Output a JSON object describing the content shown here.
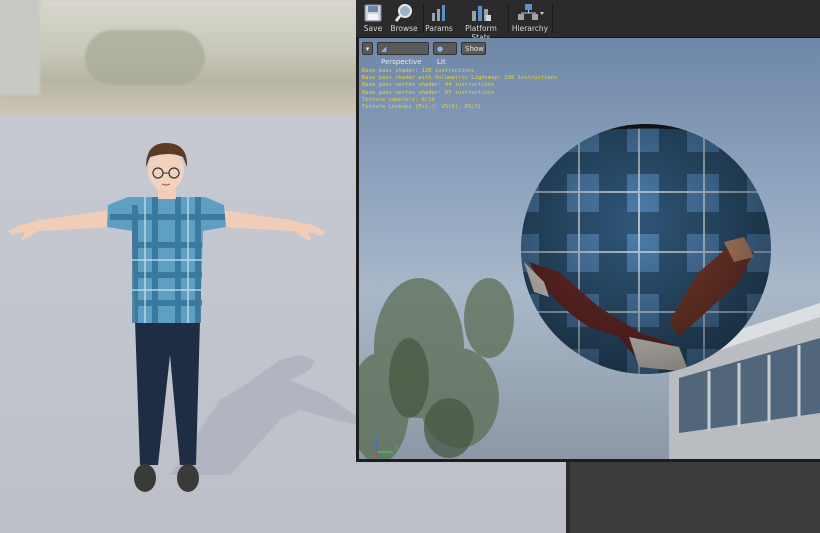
{
  "toolbar": {
    "buttons": [
      {
        "label": "Save",
        "icon": "save-icon"
      },
      {
        "label": "Browse",
        "icon": "browse-icon"
      },
      {
        "label": "Params",
        "icon": "params-icon"
      },
      {
        "label": "Platform Stats",
        "icon": "platform-stats-icon"
      },
      {
        "label": "Hierarchy",
        "icon": "hierarchy-icon"
      }
    ]
  },
  "viewport": {
    "view_mode": "Perspective",
    "lighting": "Lit",
    "show": "Show",
    "stats": [
      "Base pass shader: 128 instructions",
      "Base pass shader with Volumetric Lightmap: 206 instructions",
      "Base pass vertex shader: 44 instructions",
      "Base pass vertex shader: 87 instructions",
      "Texture samplers: 6/16",
      "Texture Lookups (Est.): VS(0), PS(3)"
    ],
    "axis": {
      "y": "Y",
      "z": "Z"
    }
  },
  "colors": {
    "stats_text": "#e7d13a",
    "shirt": "#5f9fc4",
    "pants": "#1e2d44",
    "toolbar_bg": "#2b2b2b"
  }
}
